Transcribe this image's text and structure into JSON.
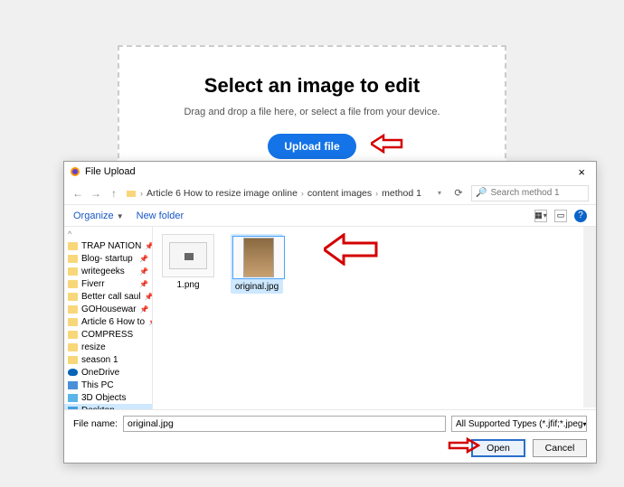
{
  "upload": {
    "heading": "Select an image to edit",
    "subtext": "Drag and drop a file here, or select a file from your device.",
    "button": "Upload file"
  },
  "dialog": {
    "title": "File Upload",
    "breadcrumb": [
      "Article 6 How to resize image online",
      "content images",
      "method 1"
    ],
    "search_placeholder": "Search method 1",
    "organize": "Organize",
    "newfolder": "New folder",
    "tree": [
      {
        "label": "TRAP NATION",
        "type": "folder",
        "pinned": true
      },
      {
        "label": "Blog- startup",
        "type": "folder",
        "pinned": true
      },
      {
        "label": "writegeeks",
        "type": "folder",
        "pinned": true
      },
      {
        "label": "Fiverr",
        "type": "folder",
        "pinned": true
      },
      {
        "label": "Better call saul",
        "type": "folder",
        "pinned": true
      },
      {
        "label": "GOHousewar",
        "type": "folder",
        "pinned": true
      },
      {
        "label": "Article 6 How to",
        "type": "folder",
        "pinned": true
      },
      {
        "label": "COMPRESS",
        "type": "folder"
      },
      {
        "label": "resize",
        "type": "folder"
      },
      {
        "label": "season 1",
        "type": "folder"
      },
      {
        "label": "OneDrive",
        "type": "onedrive"
      },
      {
        "label": "This PC",
        "type": "pc"
      },
      {
        "label": "3D Objects",
        "type": "obj"
      },
      {
        "label": "Desktop",
        "type": "desk",
        "selected": true
      }
    ],
    "files": [
      {
        "name": "1.png",
        "selected": false
      },
      {
        "name": "original.jpg",
        "selected": true
      }
    ],
    "filename_label": "File name:",
    "filename_value": "original.jpg",
    "filter": "All Supported Types (*.jfif;*.jpeg",
    "open": "Open",
    "cancel": "Cancel"
  }
}
